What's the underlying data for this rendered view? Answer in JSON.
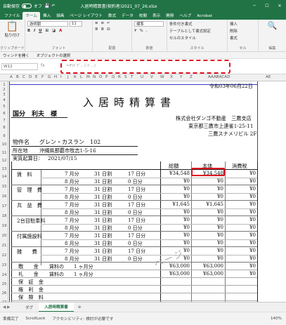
{
  "titlebar": {
    "autosave": "自動保存",
    "autosave_state": "オフ",
    "title": "入居時精算書(契約者)2021_07_26.xlsx"
  },
  "tabs": [
    "ファイル",
    "ホーム",
    "挿入",
    "描画",
    "ページ レイアウト",
    "数式",
    "データ",
    "校閲",
    "表示",
    "開発",
    "ヘルプ",
    "Acrobat"
  ],
  "ribbon": {
    "paste": "貼り付け",
    "clipboard": "クリップボード",
    "font_name": "游明朝",
    "font_size": "11",
    "font": "フォント",
    "align": "配置",
    "number_format": "標準",
    "number": "数値",
    "cond_format": "条件付き書式",
    "table_format": "テーブルとして書式設定",
    "cell_style": "セルのスタイル",
    "styles": "スタイル",
    "insert": "挿入",
    "delete": "削除",
    "format": "書式",
    "cells": "セル",
    "edit": "編集"
  },
  "qat": {
    "mail": "ウィンドを開く",
    "object": "オブジェクトの選択"
  },
  "formula": {
    "namebox": "W12",
    "fx": "fx",
    "value": "=IF(ｷﾞﾁﾞ...ｺﾞｾﾞ...)"
  },
  "columns": [
    "A",
    "B",
    "C",
    "D",
    "E",
    "F",
    "G",
    "H",
    "I",
    "J",
    "K",
    "L",
    "M",
    "N",
    "O",
    "P",
    "Q",
    "R",
    "S",
    "T",
    "U",
    "V",
    "W",
    "X",
    "Y",
    "Z",
    "AAABACAD",
    "AE"
  ],
  "rows": [
    "1",
    "2",
    "3",
    "4",
    "5",
    "6",
    "7",
    "8",
    "9",
    "10",
    "11",
    "12",
    "13",
    "14",
    "15",
    "16",
    "17",
    "18",
    "19",
    "20",
    "21",
    "22",
    "23",
    "24",
    "25",
    "26",
    "27",
    "28"
  ],
  "sheet": {
    "date": "令和03年06月22日",
    "title": "入居時精算書",
    "customer": "国分　利夫　様",
    "company": "株式会社ダンゴ不動産　三鷹支店",
    "address": "東京都三鷹市上連雀1-25-11",
    "building": "三鷹スナメリビル 2F",
    "property_label": "物件名",
    "property": "グレン・カスラン　102",
    "location_label": "所在地",
    "location": "沖縄県那覇市牧志1-5-16",
    "contract_label": "実質起算日：",
    "contract_date": "2021/07/15",
    "h_total": "総額",
    "h_body": "本体",
    "h_tax": "消費税",
    "lines": [
      {
        "item": "賃　料",
        "m1": "7 月分",
        "d1": "31 日割",
        "p1": "17 日分",
        "m2": "8 月分",
        "d2": "31 日割",
        "p2": "0 日分",
        "total": "¥34,548",
        "body": "¥34,548",
        "tax": "¥0",
        "t2": "¥0",
        "b2": "¥0",
        "x2": "¥0"
      },
      {
        "item": "管　理　費",
        "m1": "7 月分",
        "d1": "31 日割",
        "p1": "17 日分",
        "m2": "8 月分",
        "d2": "31 日割",
        "p2": "0 日分",
        "total": "¥0",
        "body": "¥0",
        "tax": "¥0",
        "t2": "¥0",
        "b2": "¥0",
        "x2": "¥0"
      },
      {
        "item": "共　益　費",
        "m1": "7 月分",
        "d1": "31 日割",
        "p1": "17 日分",
        "m2": "8 月分",
        "d2": "31 日割",
        "p2": "0 日分",
        "total": "¥1,645",
        "body": "¥1,645",
        "tax": "¥0",
        "t2": "¥0",
        "b2": "¥0",
        "x2": "¥0"
      },
      {
        "item": "2台目駐車料",
        "m1": "7 月分",
        "d1": "31 日割",
        "p1": "17 日分",
        "m2": "8 月分",
        "d2": "31 日割",
        "p2": "0 日分",
        "total": "¥0",
        "body": "¥0",
        "tax": "¥0",
        "t2": "¥0",
        "b2": "¥0",
        "x2": "¥0"
      },
      {
        "item": "付属施設料",
        "m1": "7 月分",
        "d1": "31 日割",
        "p1": "17 日分",
        "m2": "8 月分",
        "d2": "31 日割",
        "p2": "0 日分",
        "total": "¥0",
        "body": "¥0",
        "tax": "¥0",
        "t2": "¥0",
        "b2": "¥0",
        "x2": "¥0"
      },
      {
        "item": "雑　　費",
        "m1": "7 月分",
        "d1": "31 日割",
        "p1": "17 日分",
        "m2": "8 月分",
        "d2": "31 日割",
        "p2": "0 日分",
        "total": "¥0",
        "body": "¥0",
        "tax": "¥0",
        "t2": "¥0",
        "b2": "¥0",
        "x2": "¥0"
      }
    ],
    "deposits": [
      {
        "item": "敷　　金",
        "note": "賃料の　　1 ヶ月分",
        "total": "¥63,000",
        "body": "¥63,000",
        "tax": "¥0"
      },
      {
        "item": "礼　　金",
        "note": "賃料の　　1 ヶ月分",
        "total": "¥63,000",
        "body": "¥63,000",
        "tax": "¥0"
      },
      {
        "item": "保　証　金",
        "note": "",
        "total": "",
        "body": "",
        "tax": ""
      },
      {
        "item": "権　利　金",
        "note": "",
        "total": "",
        "body": "",
        "tax": ""
      },
      {
        "item": "保　険　料",
        "note": "",
        "total": "",
        "body": "",
        "tax": ""
      }
    ],
    "watermark": "ページ"
  },
  "sheettabs": [
    "ダグ",
    "入居時精算書"
  ],
  "status": {
    "ready": "準備完了",
    "scroll": "ScrollLock",
    "access": "アクセシビリティ: 検討が必要です",
    "zoom": "140%"
  }
}
